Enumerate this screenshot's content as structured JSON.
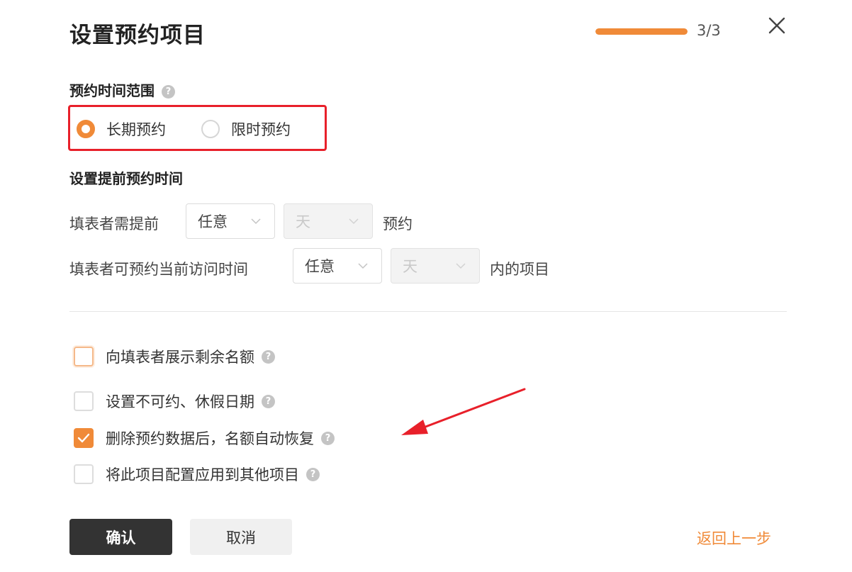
{
  "header": {
    "title": "设置预约项目",
    "progress_text": "3/3",
    "progress_fraction": 1.0
  },
  "time_range": {
    "title": "预约时间范围",
    "options": [
      {
        "label": "长期预约",
        "checked": true
      },
      {
        "label": "限时预约",
        "checked": false
      }
    ]
  },
  "advance": {
    "title": "设置提前预约时间",
    "row1": {
      "label": "填表者需提前",
      "select1": "任意",
      "select2": "天",
      "suffix": "预约"
    },
    "row2": {
      "label": "填表者可预约当前访问时间",
      "select1": "任意",
      "select2": "天",
      "suffix": "内的项目"
    }
  },
  "options": [
    {
      "label": "向填表者展示剩余名额",
      "checked": false
    },
    {
      "label": "设置不可约、休假日期",
      "checked": false
    },
    {
      "label": "删除预约数据后，名额自动恢复",
      "checked": true
    },
    {
      "label": "将此项目配置应用到其他项目",
      "checked": false
    }
  ],
  "footer": {
    "confirm": "确认",
    "cancel": "取消",
    "back": "返回上一步"
  },
  "colors": {
    "accent": "#f08a38",
    "highlight": "#e8202a",
    "primary_button": "#333333"
  },
  "icons": {
    "close": "close-icon",
    "help": "help-icon",
    "chevron": "chevron-down-icon",
    "check": "check-icon",
    "annotation": "arrow-annotation"
  }
}
